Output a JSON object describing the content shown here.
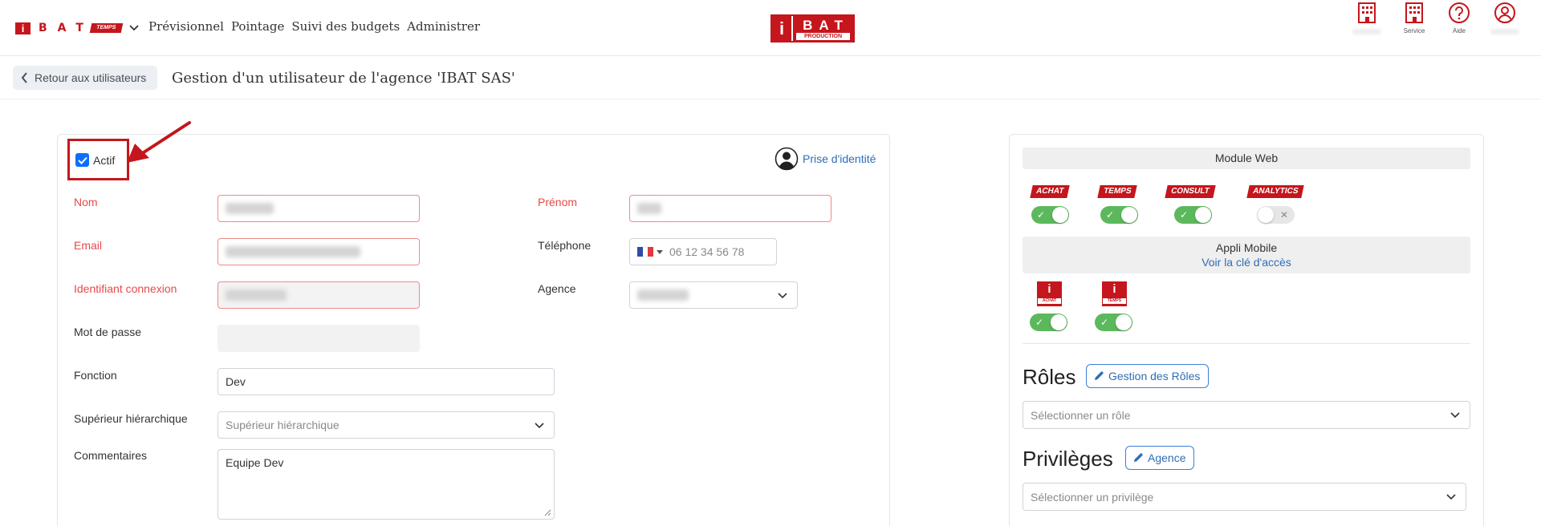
{
  "nav": {
    "brand_letters": "BAT",
    "brand_tag": "TEMPS",
    "links": [
      "Prévisionnel",
      "Pointage",
      "Suivi des budgets",
      "Administrer"
    ],
    "center_logo": {
      "letters": "BAT",
      "tagline": "PRODUCTION"
    },
    "icons": [
      {
        "name": "building-icon",
        "label": ""
      },
      {
        "name": "building-service-icon",
        "label": "Service"
      },
      {
        "name": "help-icon",
        "label": "Aide"
      },
      {
        "name": "user-icon",
        "label": ""
      }
    ]
  },
  "subheader": {
    "back_label": "Retour aux utilisateurs",
    "title": "Gestion d'un utilisateur de l'agence 'IBAT SAS'"
  },
  "form": {
    "actif_label": "Actif",
    "actif_checked": true,
    "prise_label": "Prise d'identité",
    "labels": {
      "nom": "Nom",
      "prenom": "Prénom",
      "email": "Email",
      "telephone": "Téléphone",
      "identifiant": "Identifiant connexion",
      "agence": "Agence",
      "mot_de_passe": "Mot de passe",
      "fonction": "Fonction",
      "superieur": "Supérieur hiérarchique",
      "commentaires": "Commentaires"
    },
    "values": {
      "fonction": "Dev",
      "commentaires": "Equipe Dev"
    },
    "placeholders": {
      "telephone": "06 12 34 56 78",
      "superieur": "Supérieur hiérarchique"
    }
  },
  "right": {
    "module_web_title": "Module Web",
    "web_modules": [
      {
        "label": "ACHAT",
        "enabled": true
      },
      {
        "label": "TEMPS",
        "enabled": true
      },
      {
        "label": "CONSULT",
        "enabled": true
      },
      {
        "label": "ANALYTICS",
        "enabled": false
      }
    ],
    "appli_mobile_title": "Appli Mobile",
    "voir_cle_label": "Voir la clé d'accès",
    "mobile_apps": [
      {
        "label": "ACHAT",
        "enabled": true
      },
      {
        "label": "TEMPS",
        "enabled": true
      }
    ],
    "roles_title": "Rôles",
    "roles_button": "Gestion des Rôles",
    "roles_placeholder": "Sélectionner un rôle",
    "privileges_title": "Privilèges",
    "privileges_button": "Agence",
    "privileges_placeholder": "Sélectionner un privilège"
  },
  "colors": {
    "brand_red": "#c4161c",
    "toggle_on": "#5cb85c",
    "link_blue": "#2f6db5",
    "required_red": "#e74a4a"
  }
}
